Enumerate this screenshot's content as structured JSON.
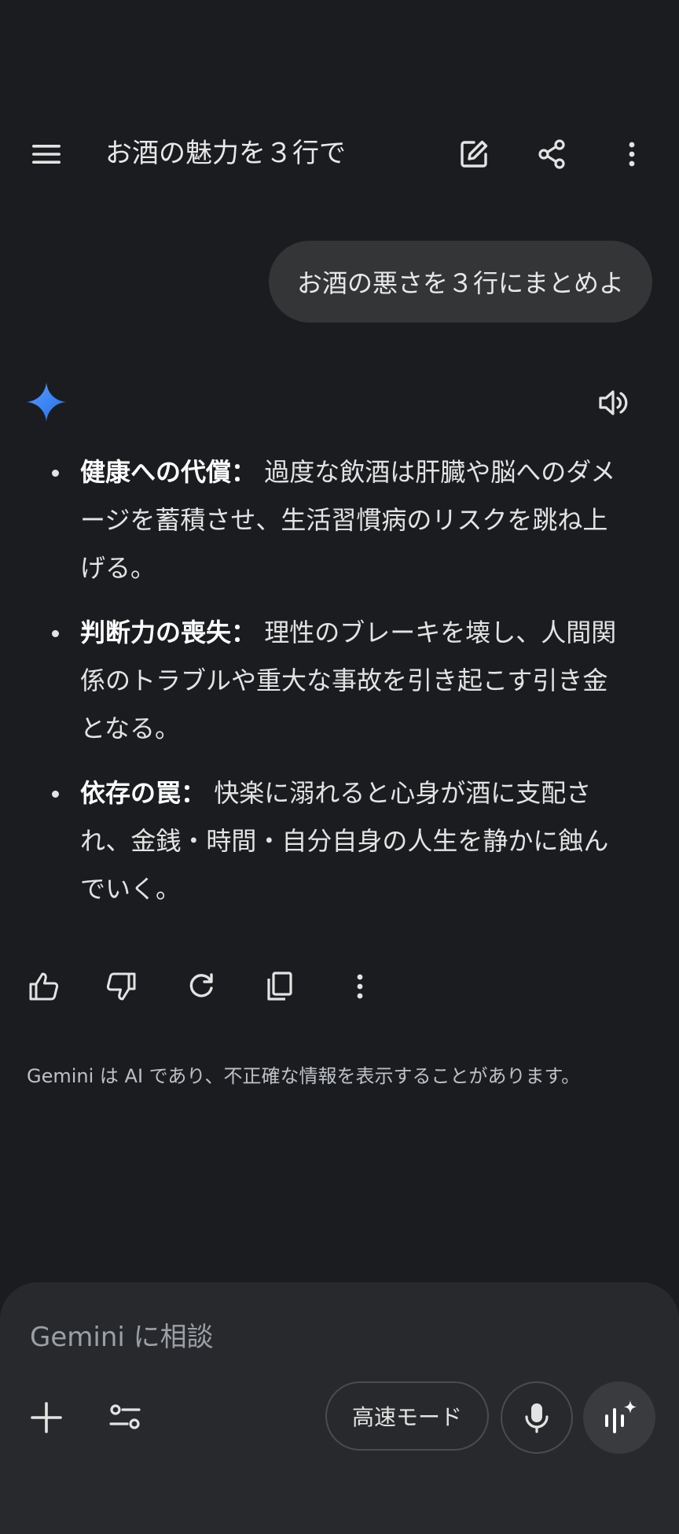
{
  "header": {
    "title": "お酒の魅力を３行で",
    "icons": [
      "menu-icon",
      "edit-icon",
      "share-icon",
      "more-vert-icon"
    ]
  },
  "user_message": "お酒の悪さを３行にまとめよ",
  "response": {
    "items": [
      {
        "heading": "健康への代償：",
        "lines": [
          "過度な飲酒は肝臓や脳へのダメ",
          "ージを蓄積させ、生活習慣病のリスクを跳ね上",
          "げる。"
        ]
      },
      {
        "heading": "判断力の喪失：",
        "lines": [
          "理性のブレーキを壊し、人間関",
          "係のトラブルや重大な事故を引き起こす引き金",
          "となる。"
        ]
      },
      {
        "heading": "依存の罠：",
        "lines": [
          "快楽に溺れると心身が酒に支配さ",
          "れ、金銭・時間・自分自身の人生を静かに蝕ん",
          "でいく。"
        ]
      }
    ],
    "actions": [
      "thumbs-up-icon",
      "thumbs-down-icon",
      "regenerate-icon",
      "copy-icon",
      "more-vert-icon"
    ]
  },
  "disclaimer": "Gemini は AI であり、不正確な情報を表示することがあります。",
  "composer": {
    "placeholder": "Gemini に相談",
    "mode_label": "高速モード"
  },
  "colors": {
    "background": "#1b1c1f",
    "bubble": "#333537",
    "composer": "#28292c",
    "gemini_blue": "#4285f4"
  }
}
